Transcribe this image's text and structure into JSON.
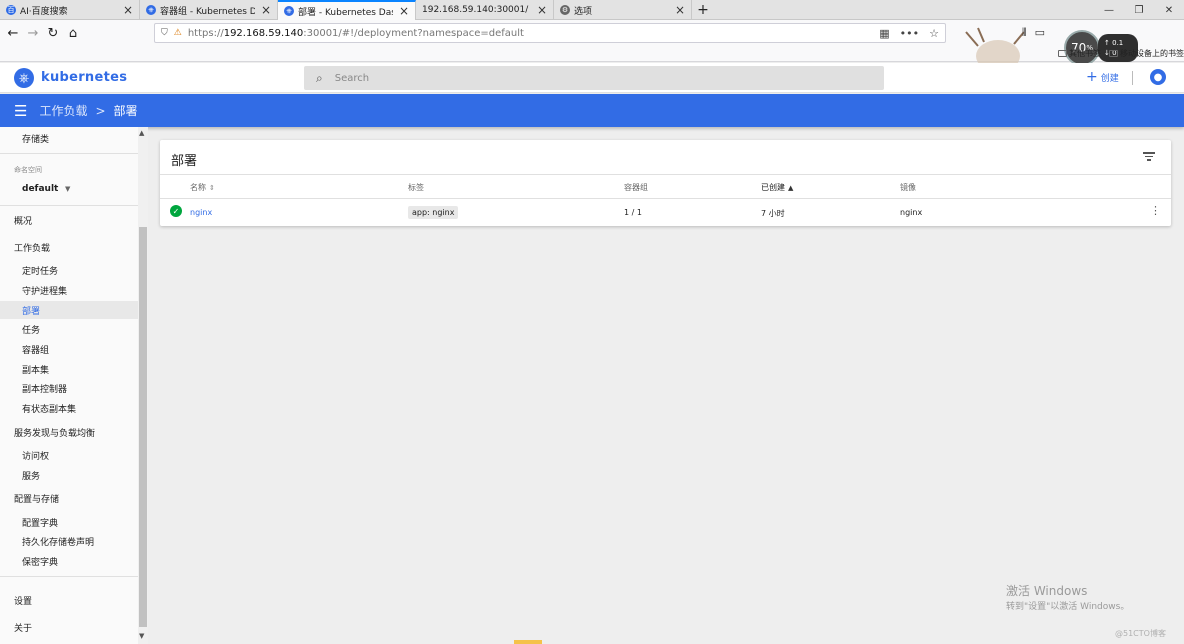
{
  "browser": {
    "tabs": [
      {
        "label": "AI·百度搜索",
        "icon": "baidu-icon",
        "active": false
      },
      {
        "label": "容器组 - Kubernetes Dashbo",
        "icon": "kubernetes-icon",
        "active": false
      },
      {
        "label": "部署 - Kubernetes Dashboard",
        "icon": "kubernetes-icon",
        "active": true
      },
      {
        "label": "192.168.59.140:30001/",
        "icon": "",
        "active": false
      },
      {
        "label": "选项",
        "icon": "gear-icon",
        "active": false
      }
    ],
    "url_proto": "https://",
    "url_host": "192.168.59.140",
    "url_rest": ":30001/#!/deployment?namespace=default",
    "bookmarks": [
      "其他书签",
      "移动设备上的书签"
    ],
    "speed_value": "70",
    "speed_unit": "%",
    "speed_up": "0.1",
    "speed_down": "0"
  },
  "app": {
    "brand": "kubernetes",
    "search_placeholder": "Search",
    "create_label": "创建"
  },
  "toolbar": {
    "crumb_parent": "工作负载",
    "crumb_separator": ">",
    "crumb_current": "部署"
  },
  "sidebar": {
    "storage_class": "存储类",
    "namespace_label": "命名空间",
    "namespace_value": "default",
    "overview": "概况",
    "workloads": "工作负载",
    "workload_items": [
      "定时任务",
      "守护进程集",
      "部署",
      "任务",
      "容器组",
      "副本集",
      "副本控制器",
      "有状态副本集"
    ],
    "discovery": "服务发现与负载均衡",
    "discovery_items": [
      "访问权",
      "服务"
    ],
    "config": "配置与存储",
    "config_items": [
      "配置字典",
      "持久化存储卷声明",
      "保密字典"
    ],
    "settings": "设置",
    "about": "关于"
  },
  "card": {
    "title": "部署",
    "columns": [
      "名称",
      "标签",
      "容器组",
      "已创建",
      "镜像"
    ],
    "rows": [
      {
        "name": "nginx",
        "label": "app: nginx",
        "pods": "1 / 1",
        "created": "7 小时",
        "image": "nginx",
        "status": "running"
      }
    ]
  },
  "overlay": {
    "watermark_title": "激活 Windows",
    "watermark_sub": "转到\"设置\"以激活 Windows。",
    "credit": "@51CTO博客"
  },
  "colors": {
    "brand": "#326ce5",
    "status_ok": "#00a63e"
  }
}
